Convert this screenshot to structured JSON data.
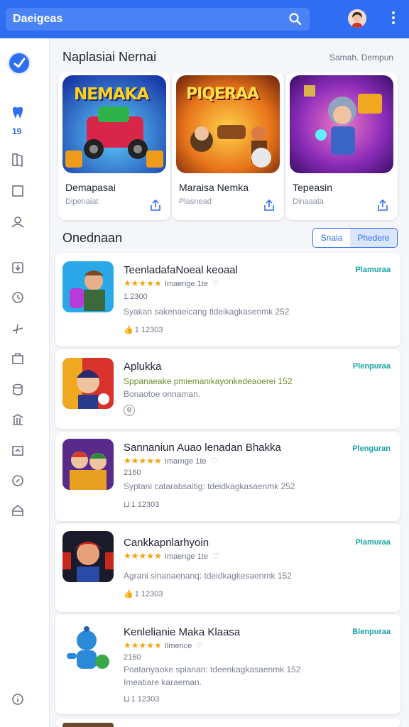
{
  "topbar": {
    "search_label": "Daeigeas"
  },
  "sidebar": {
    "badge": "19"
  },
  "featured": {
    "title": "Naplasiai Nernai",
    "link": "Samah. Dempun",
    "cards": [
      {
        "art": "NEMAKA",
        "title": "Demapasai",
        "sub": "Dipenaiat"
      },
      {
        "art": "PIQERAA",
        "title": "Maraisa Nemka",
        "sub": "Plasnead"
      },
      {
        "art": "",
        "title": "Tepeasin",
        "sub": "Dinaaata"
      }
    ]
  },
  "list": {
    "title": "Onednaan",
    "toggle": [
      "Snaia",
      "Phedere"
    ],
    "items": [
      {
        "title": "TeenladafaNoeal keoaal",
        "action": "Plamuraa",
        "stars": "★★★★★",
        "rating": "Imaenge 1te",
        "line1": "1.2300",
        "desc": "Syakan sakenaeicang tldeikagkasenmk 252",
        "meta": "1 12303"
      },
      {
        "title": "Aplukka",
        "action": "Plenpuraa",
        "desc_green": "Sppanaeake pmiemanikayonkedeaoerei 152",
        "desc2": "Bonaotoe onnaman.",
        "meta": ""
      },
      {
        "title": "Sannaniun Auao lenadan Bhakka",
        "action": "Plenguran",
        "stars": "★★★★★",
        "rating": "Imarnge 1te",
        "line1": "2160",
        "desc": "Syptani catarabsaitig: tdeidkagkasaenmk 252",
        "meta": "1 12303"
      },
      {
        "title": "Cankkapnlarhyoin",
        "action": "Plamuraa",
        "stars": "★★★★★",
        "rating": "Imaenge 1te",
        "desc": "Agrani sinanaenanq: tdeidkagkesaenmk 152",
        "meta": "1 12303"
      },
      {
        "title": "Kenlelianie Maka Klaasa",
        "action": "Blenpuraa",
        "stars": "★★★★★",
        "rating": "Ilmence",
        "line1": "2160",
        "desc": "Poatanyaoke splanan: tdeenkagkasaenmk 152",
        "desc2": "Imeatiare karaeman.",
        "meta": "1 12303"
      }
    ]
  },
  "colors": {
    "accent": "#2f6ef2",
    "action": "#17a3a6",
    "star": "#f2a510"
  }
}
